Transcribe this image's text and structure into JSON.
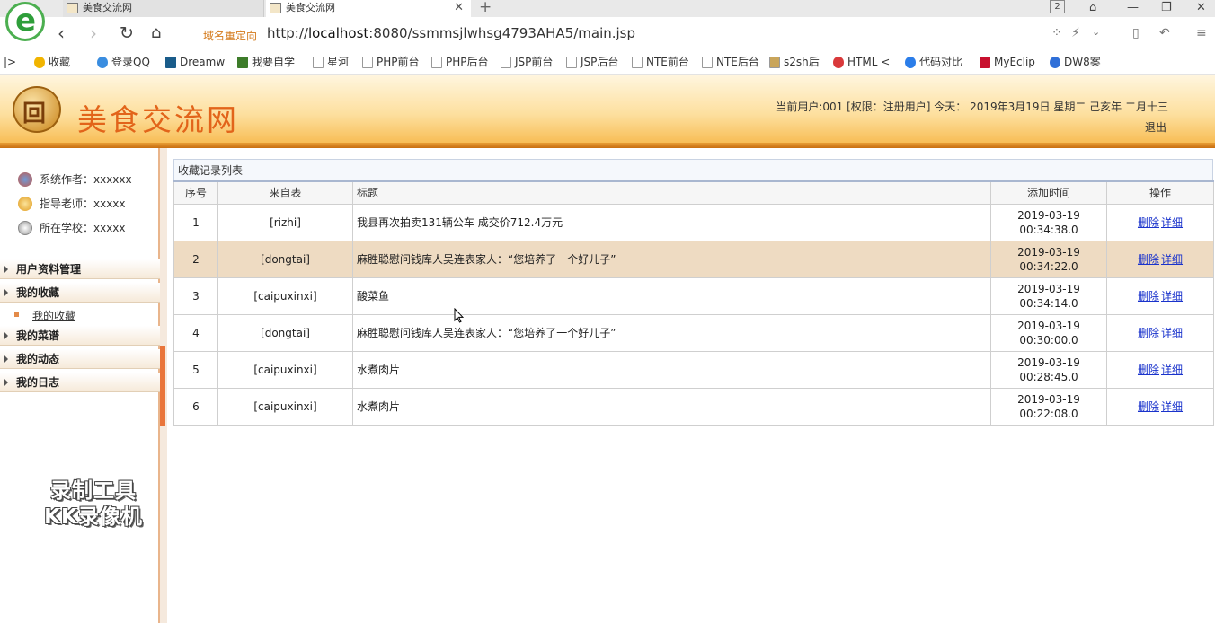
{
  "browser": {
    "tabs": [
      {
        "label": "美食交流网",
        "active": false
      },
      {
        "label": "美食交流网",
        "active": true
      }
    ],
    "tab_count": "2",
    "redirect_label": "域名重定向",
    "url_prefix": "http://",
    "url_host": "localhost",
    "url_rest": ":8080/ssmmsjlwhsg4793AHA5/main.jsp",
    "bookmarks": [
      {
        "label": "收藏",
        "icon": "star-icon"
      },
      {
        "label": "登录QQ",
        "icon": "qq-icon"
      },
      {
        "label": "Dreamw",
        "icon": "dreamweaver-icon"
      },
      {
        "label": "我要自学",
        "icon": "book-icon"
      },
      {
        "label": "星河",
        "icon": "page-icon"
      },
      {
        "label": "PHP前台",
        "icon": "page-icon"
      },
      {
        "label": "PHP后台",
        "icon": "page-icon"
      },
      {
        "label": "JSP前台",
        "icon": "page-icon"
      },
      {
        "label": "JSP后台",
        "icon": "page-icon"
      },
      {
        "label": "NTE前台",
        "icon": "page-icon"
      },
      {
        "label": "NTE后台",
        "icon": "page-icon"
      },
      {
        "label": "s2sh后",
        "icon": "image-icon"
      },
      {
        "label": "HTML <",
        "icon": "html-icon"
      },
      {
        "label": "代码对比",
        "icon": "compare-icon"
      },
      {
        "label": "MyEclip",
        "icon": "myeclipse-icon"
      },
      {
        "label": "DW8案",
        "icon": "paw-icon"
      }
    ]
  },
  "header": {
    "logo_glyph": "回",
    "site_title": "美食交流网",
    "user_info": "当前用户:001 [权限：注册用户] 今天： 2019年3月19日 星期二 己亥年 二月十三",
    "logout_label": "退出"
  },
  "sidebar": {
    "info": [
      {
        "label": "系统作者：xxxxxx",
        "icon": "users-icon"
      },
      {
        "label": "指导老师：xxxxx",
        "icon": "alarm-icon"
      },
      {
        "label": "所在学校：xxxxx",
        "icon": "clock-icon"
      }
    ],
    "menus": [
      {
        "label": "用户资料管理"
      },
      {
        "label": "我的收藏",
        "sub": "我的收藏"
      },
      {
        "label": "我的菜谱"
      },
      {
        "label": "我的动态"
      },
      {
        "label": "我的日志"
      }
    ],
    "watermark_line1": "录制工具",
    "watermark_line2": "KK录像机"
  },
  "main": {
    "list_title": "收藏记录列表",
    "columns": [
      "序号",
      "来自表",
      "标题",
      "添加时间",
      "操作"
    ],
    "rows": [
      {
        "index": "1",
        "table": "[rizhi]",
        "title": "我县再次拍卖131辆公车 成交价712.4万元",
        "date": "2019-03-19",
        "time": "00:34:38.0",
        "highlight": false
      },
      {
        "index": "2",
        "table": "[dongtai]",
        "title": "麻胜聪慰问钱库人吴连表家人：“您培养了一个好儿子”",
        "date": "2019-03-19",
        "time": "00:34:22.0",
        "highlight": true
      },
      {
        "index": "3",
        "table": "[caipuxinxi]",
        "title": "酸菜鱼",
        "date": "2019-03-19",
        "time": "00:34:14.0",
        "highlight": false
      },
      {
        "index": "4",
        "table": "[dongtai]",
        "title": "麻胜聪慰问钱库人吴连表家人：“您培养了一个好儿子”",
        "date": "2019-03-19",
        "time": "00:30:00.0",
        "highlight": false
      },
      {
        "index": "5",
        "table": "[caipuxinxi]",
        "title": "水煮肉片",
        "date": "2019-03-19",
        "time": "00:28:45.0",
        "highlight": false
      },
      {
        "index": "6",
        "table": "[caipuxinxi]",
        "title": "水煮肉片",
        "date": "2019-03-19",
        "time": "00:22:08.0",
        "highlight": false
      }
    ],
    "op_delete": "删除",
    "op_detail": "详细"
  },
  "colors": {
    "accent": "#e2641a",
    "header_gradient_end": "#f7b748",
    "row_highlight": "#eedbc2",
    "link": "#1a33cc"
  }
}
